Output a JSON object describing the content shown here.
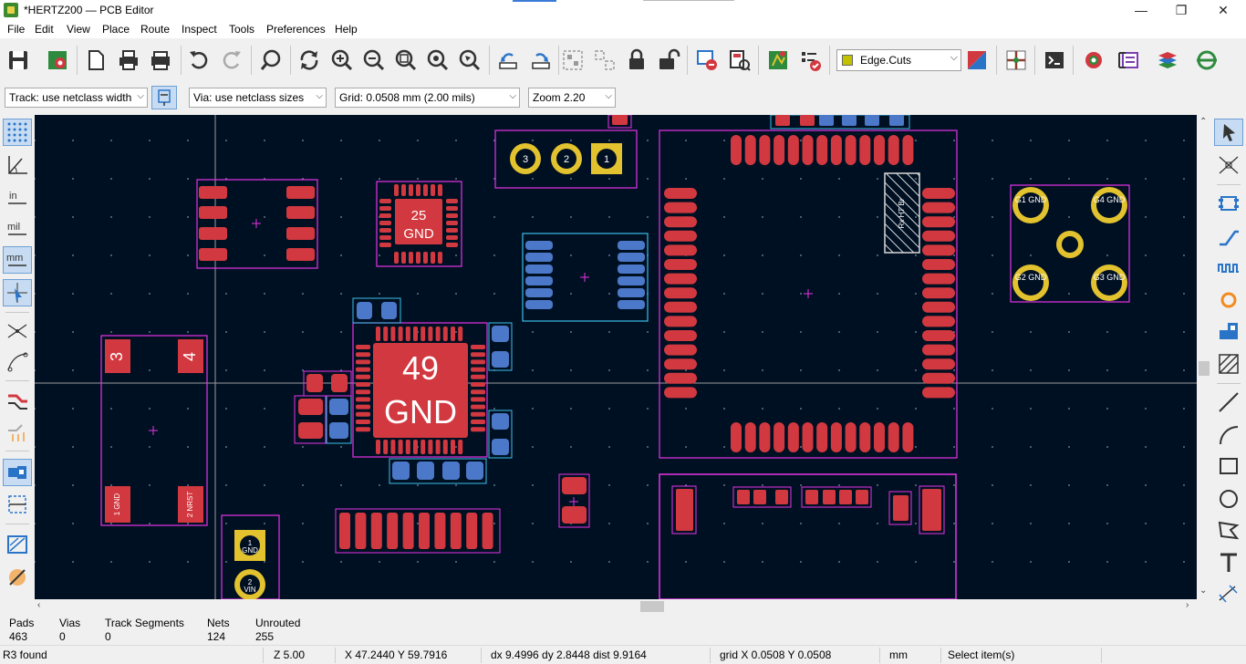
{
  "window": {
    "title": "*HERTZ200 — PCB Editor",
    "controls": [
      "—",
      "❐",
      "✕"
    ]
  },
  "menu": [
    "File",
    "Edit",
    "View",
    "Place",
    "Route",
    "Inspect",
    "Tools",
    "Preferences",
    "Help"
  ],
  "toolbar": {
    "icons": [
      "save-icon",
      "board-setup-icon",
      "page-settings-icon",
      "print-icon",
      "plot-icon",
      "undo-icon",
      "redo-icon",
      "find-icon",
      "refresh-icon",
      "zoom-in-icon",
      "zoom-out-icon",
      "zoom-fit-icon",
      "zoom-objects-icon",
      "zoom-selection-icon",
      "rotate-ccw-icon",
      "rotate-cw-icon",
      "group-icon",
      "ungroup-icon",
      "lock-icon",
      "unlock-icon",
      "update-pcb-icon",
      "footprint-editor-icon",
      "scripting-icon",
      "drc-icon",
      "netlist-icon",
      "route-track-icon",
      "python-console-icon",
      "show-3d-icon",
      "cross-probe-icon",
      "layer-display-icon",
      "edit-fp-icon"
    ],
    "active_layer": "Edge.Cuts"
  },
  "toolbar2": {
    "track": "Track: use netclass width",
    "via": "Via: use netclass sizes",
    "grid": "Grid: 0.0508 mm (2.00 mils)",
    "zoom": "Zoom 2.20"
  },
  "board": {
    "pad_labels": {
      "u1_big_num": "49",
      "u1_big_net": "GND",
      "u2_num": "25",
      "u2_net": "GND",
      "sw_3": "3",
      "sw_4": "4",
      "sw_1": "1 GND",
      "sw_2": "2 NRST",
      "j_g1": "G1 GND",
      "j_g2": "G2 GND",
      "j_g3": "G3 GND",
      "j_g4": "G4 GND",
      "hdr_3": "3",
      "hdr_2": "2",
      "hdr_1": "1",
      "j2_1": "1",
      "j2_2": "2",
      "j2_1n": "GND",
      "j2_2n": "VIN",
      "antenna_label": "Rx HT Br"
    }
  },
  "info": {
    "pads_label": "Pads",
    "pads": "463",
    "vias_label": "Vias",
    "vias": "0",
    "tracks_label": "Track Segments",
    "tracks": "0",
    "nets_label": "Nets",
    "nets": "124",
    "unrouted_label": "Unrouted",
    "unrouted": "255"
  },
  "status": {
    "found": "R3 found",
    "zoom": "Z 5.00",
    "coords": "X 47.2440  Y 59.7916",
    "delta": "dx 9.4996  dy 2.8448  dist 9.9164",
    "grid": "grid X 0.0508  Y 0.0508",
    "units": "mm",
    "tool": "Select item(s)"
  },
  "colors": {
    "canvas_bg": "#001023",
    "pad_front": "#d2383f",
    "pad_back": "#4b78c8",
    "courtyard": "#e633e6",
    "courtyard_back": "#3bbfe8",
    "through_hole": "#e2c22e",
    "crosshair": "#9c9c9c"
  }
}
